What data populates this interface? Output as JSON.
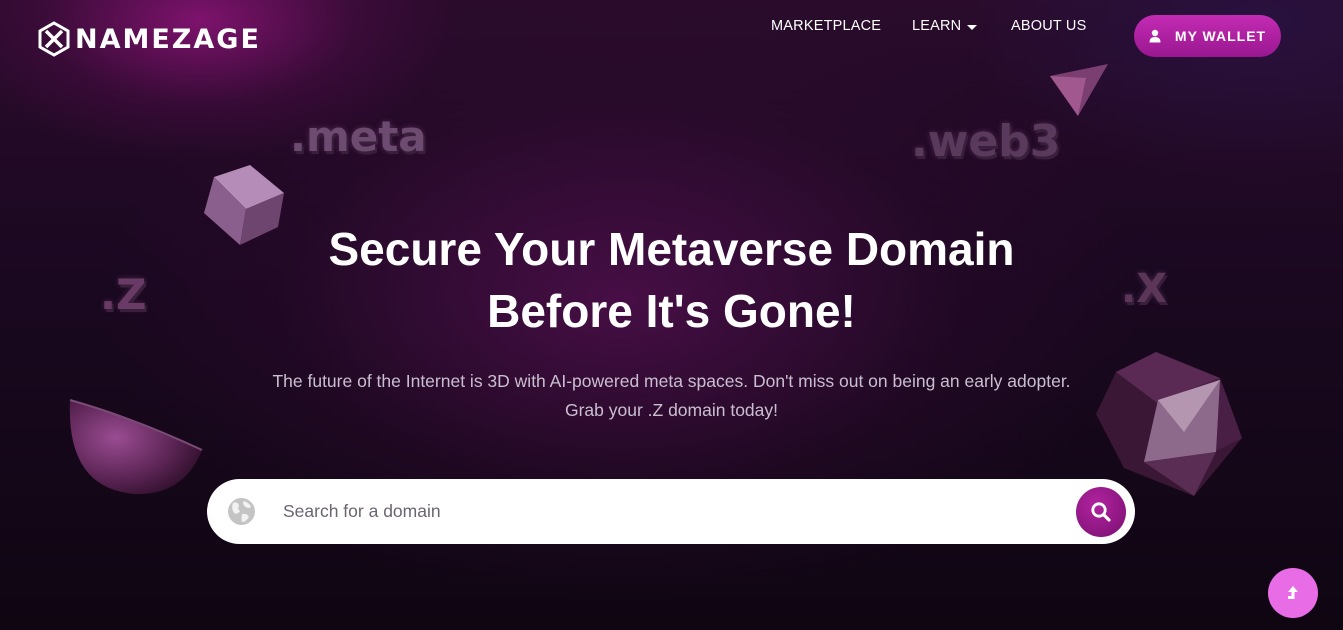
{
  "brand": {
    "name": "NAMEZAGE",
    "logo_icon": "hexagon-x-logo"
  },
  "nav": {
    "items": [
      {
        "label": "MARKETPLACE"
      },
      {
        "label": "LEARN",
        "has_dropdown": true
      },
      {
        "label": "ABOUT US"
      }
    ],
    "wallet_button": {
      "label": "MY WALLET",
      "icon": "user-icon"
    }
  },
  "decorations": {
    "floating_texts": [
      ".meta",
      ".web3",
      ".Z",
      ".X"
    ]
  },
  "hero": {
    "title_line1": "Secure Your Metaverse Domain",
    "title_line2": "Before It's Gone!",
    "subtitle_line1": "The future of the Internet is 3D with AI-powered meta spaces. Don't miss out on being an early adopter.",
    "subtitle_line2": "Grab your .Z domain today!"
  },
  "search": {
    "placeholder": "Search for a domain",
    "value": "",
    "leading_icon": "globe-icon",
    "button_icon": "search-icon"
  },
  "scroll_top": {
    "icon": "arrow-up-icon"
  },
  "colors": {
    "accent": "#b0239f",
    "wallet_button": "#c42bb4",
    "scroll_top": "#e86ce6",
    "background": "#1a0820"
  }
}
